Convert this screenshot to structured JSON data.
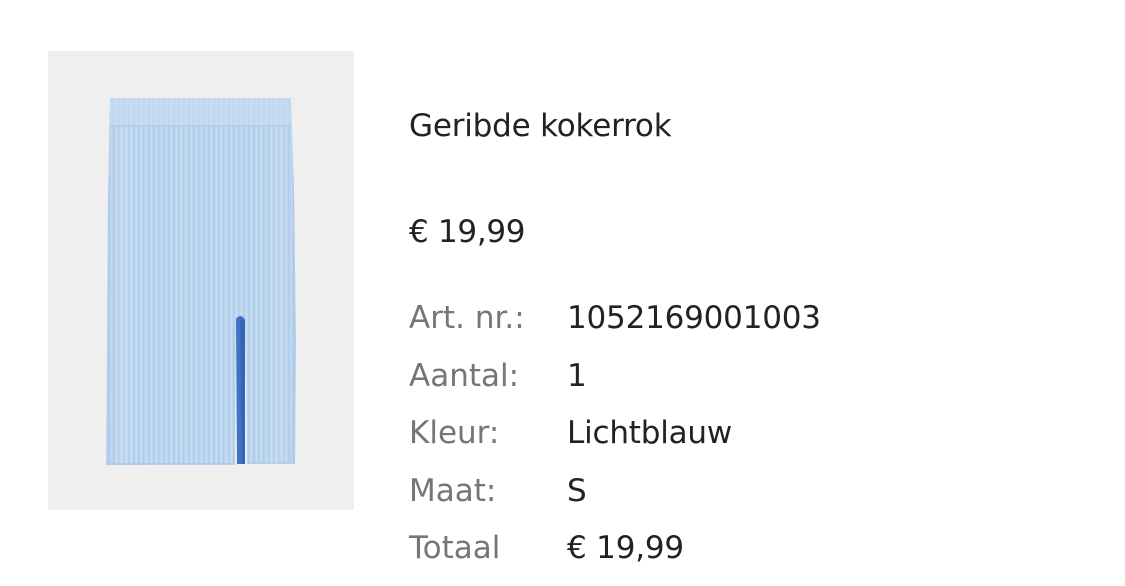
{
  "product": {
    "image_alt": "skirt-image",
    "name": "Geribde kokerrok",
    "price": "€ 19,99",
    "colors": {
      "image_background": "#efefef",
      "skirt": "#bcd5ef"
    }
  },
  "details": [
    {
      "label": "Art. nr.:",
      "value": "1052169001003"
    },
    {
      "label": "Aantal:",
      "value": "1"
    },
    {
      "label": "Kleur:",
      "value": "Lichtblauw"
    },
    {
      "label": "Maat:",
      "value": "S"
    },
    {
      "label": "Totaal",
      "value": "€ 19,99"
    }
  ]
}
